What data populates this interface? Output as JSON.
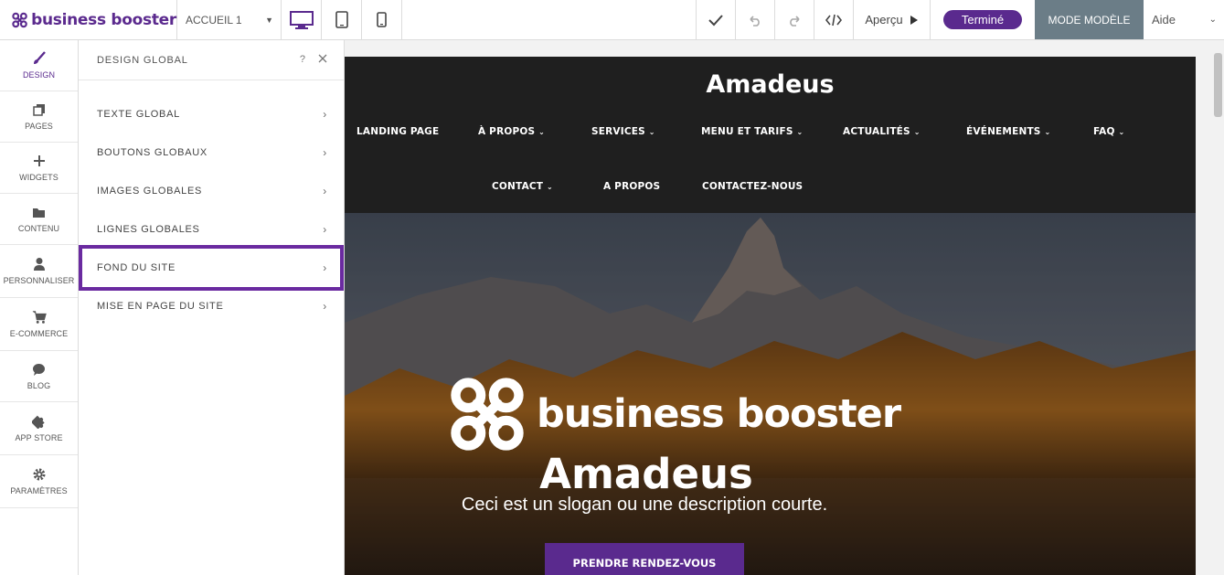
{
  "topbar": {
    "brand": "business booster",
    "page_select": "ACCUEIL 1",
    "preview_label": "Aperçu",
    "done_label": "Terminé",
    "template_mode_label": "MODE MODÈLE",
    "help_label": "Aide"
  },
  "rail": {
    "items": [
      {
        "label": "DESIGN",
        "icon": "brush-icon"
      },
      {
        "label": "PAGES",
        "icon": "pages-icon"
      },
      {
        "label": "WIDGETS",
        "icon": "plus-icon"
      },
      {
        "label": "CONTENU",
        "icon": "folder-icon"
      },
      {
        "label": "PERSONNALISER",
        "icon": "person-icon"
      },
      {
        "label": "E-COMMERCE",
        "icon": "cart-icon"
      },
      {
        "label": "BLOG",
        "icon": "chat-icon"
      },
      {
        "label": "APP STORE",
        "icon": "puzzle-icon"
      },
      {
        "label": "PARAMÈTRES",
        "icon": "gear-icon"
      }
    ]
  },
  "panel": {
    "title": "DESIGN GLOBAL",
    "help": "?",
    "items": [
      {
        "label": "TEXTE GLOBAL"
      },
      {
        "label": "BOUTONS GLOBAUX"
      },
      {
        "label": "IMAGES GLOBALES"
      },
      {
        "label": "LIGNES GLOBALES"
      },
      {
        "label": "FOND DU SITE"
      },
      {
        "label": "MISE EN PAGE DU SITE"
      }
    ]
  },
  "site": {
    "title": "Amadeus",
    "nav_row1": [
      "LANDING PAGE",
      "À PROPOS",
      "SERVICES",
      "MENU ET TARIFS",
      "ACTUALITÉS",
      "ÉVÉNEMENTS",
      "FAQ"
    ],
    "nav_row2": [
      "CONTACT",
      "A PROPOS",
      "CONTACTEZ-NOUS"
    ],
    "hero": {
      "brand": "business booster",
      "title": "Amadeus",
      "slogan": "Ceci est un slogan ou une description courte.",
      "cta": "PRENDRE RENDEZ-VOUS"
    }
  },
  "colors": {
    "brand_purple": "#5a2a8e",
    "mode_button": "#6b7d87",
    "header_dark": "#1f1f1f",
    "highlight_outline": "#6a2aa0"
  }
}
